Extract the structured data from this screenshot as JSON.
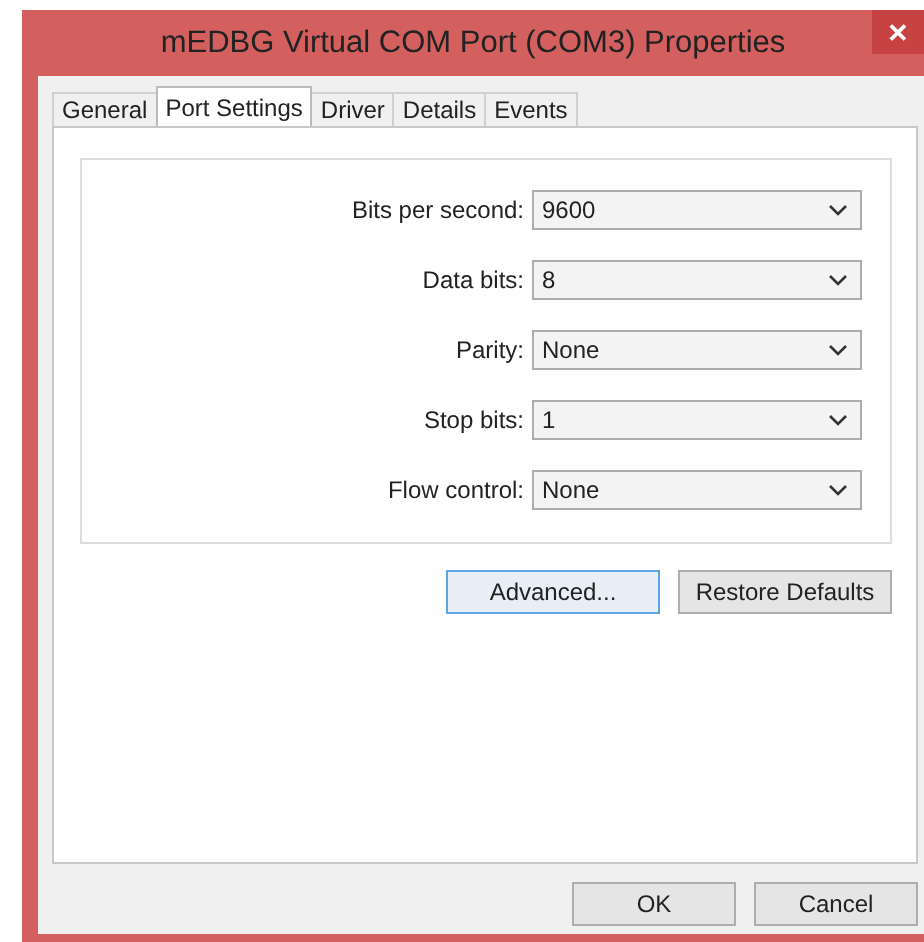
{
  "window": {
    "title": "mEDBG Virtual COM Port (COM3) Properties",
    "close": "✕"
  },
  "tabs": [
    {
      "label": "General",
      "selected": false
    },
    {
      "label": "Port Settings",
      "selected": true
    },
    {
      "label": "Driver",
      "selected": false
    },
    {
      "label": "Details",
      "selected": false
    },
    {
      "label": "Events",
      "selected": false
    }
  ],
  "settings": [
    {
      "label": "Bits per second:",
      "value": "9600"
    },
    {
      "label": "Data bits:",
      "value": "8"
    },
    {
      "label": "Parity:",
      "value": "None"
    },
    {
      "label": "Stop bits:",
      "value": "1"
    },
    {
      "label": "Flow control:",
      "value": "None"
    }
  ],
  "panel_buttons": [
    {
      "label": "Advanced...",
      "focused": true
    },
    {
      "label": "Restore Defaults",
      "focused": false
    }
  ],
  "dialog_buttons": [
    {
      "label": "OK",
      "focused": false
    },
    {
      "label": "Cancel",
      "focused": false
    }
  ]
}
